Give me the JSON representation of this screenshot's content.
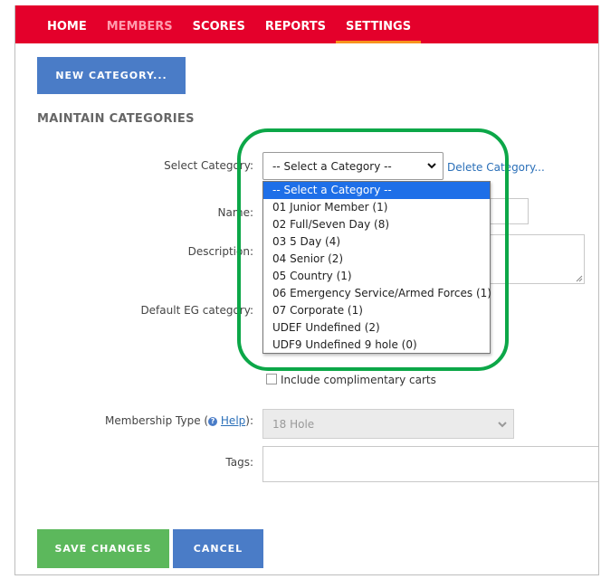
{
  "nav": {
    "items": [
      {
        "label": "HOME",
        "state": "normal"
      },
      {
        "label": "MEMBERS",
        "state": "dim"
      },
      {
        "label": "SCORES",
        "state": "normal"
      },
      {
        "label": "REPORTS",
        "state": "normal"
      },
      {
        "label": "SETTINGS",
        "state": "active"
      }
    ]
  },
  "toolbar": {
    "new_category_label": "NEW CATEGORY..."
  },
  "section_title": "MAINTAIN CATEGORIES",
  "form": {
    "select_category_label": "Select Category:",
    "select_category_value": "-- Select a Category --",
    "delete_link": "Delete Category...",
    "name_label": "Name:",
    "description_label": "Description:",
    "default_eg_label": "Default EG category:",
    "complimentary_label": "Include complimentary carts",
    "membership_type_prefix": "Membership Type (",
    "membership_type_help": "Help",
    "membership_type_suffix": "):",
    "membership_type_value": "18 Hole",
    "tags_label": "Tags:"
  },
  "dropdown": {
    "options": [
      "-- Select a Category --",
      "01 Junior Member (1)",
      "02 Full/Seven Day (8)",
      "03 5 Day (4)",
      "04 Senior (2)",
      "05 Country (1)",
      "06 Emergency Service/Armed Forces (1)",
      "07 Corporate (1)",
      "UDEF Undefined (2)",
      "UDF9 Undefined 9 hole (0)"
    ],
    "selected_index": 0
  },
  "footer": {
    "save_label": "SAVE CHANGES",
    "cancel_label": "CANCEL"
  },
  "colors": {
    "brand": "#e4002b",
    "button_blue": "#4a7cc7",
    "save_green": "#5cb85c",
    "annotation": "#0ca748"
  }
}
